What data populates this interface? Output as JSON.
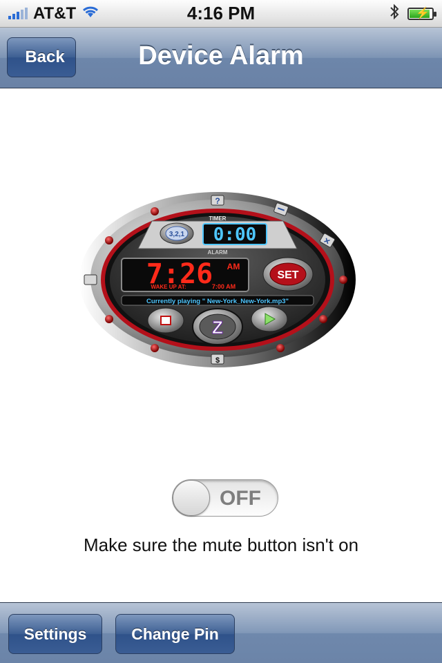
{
  "status_bar": {
    "carrier": "AT&T",
    "time": "4:16 PM",
    "battery_level": 0.9
  },
  "nav": {
    "back_label": "Back",
    "title": "Device Alarm"
  },
  "clock": {
    "timer_label": "TIMER",
    "timer_value": "0:00",
    "countdown_label": "3,2,1",
    "alarm_label": "ALARM",
    "alarm_time": "7:26",
    "alarm_ampm": "AM",
    "wake_label": "WAKE UP AT:",
    "wake_time": "7:00 AM",
    "set_label": "SET",
    "snooze_label": "Z",
    "now_playing": "Currently playing \" New-York_New-York.mp3\"",
    "help_icon_label": "?",
    "minus_icon_label": "−",
    "close_icon_label": "✕",
    "money_icon_label": "$"
  },
  "toggle": {
    "label": "OFF",
    "on": false
  },
  "message": "Make sure the mute button isn't on",
  "toolbar": {
    "settings_label": "Settings",
    "change_pin_label": "Change Pin"
  },
  "colors": {
    "nav_blue": "#6d86aa",
    "led_red": "#ff2a1a",
    "led_blue": "#4ec6ff",
    "ring_red": "#b4101a"
  }
}
